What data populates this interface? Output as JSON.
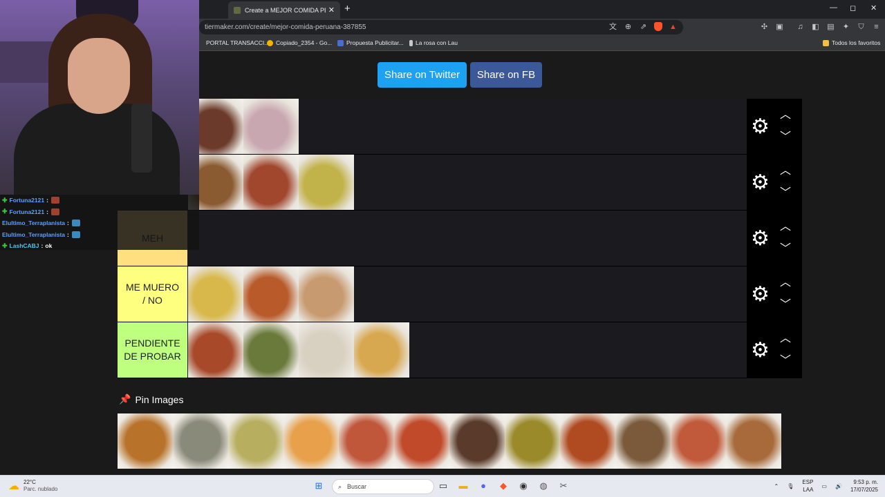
{
  "browser": {
    "tab_title": "Create a MEJOR COMIDA PERUANA",
    "url": "tiermaker.com/create/mejor-comida-peruana-387855",
    "bookmarks": [
      "PORTAL TRANSACCI...",
      "Copiado_2354 - Go...",
      "Propuesta Publicitar...",
      "La rosa con Lau"
    ],
    "bookmarks_folder": "Todos los favoritos",
    "new_tab_symbol": "+",
    "close_symbol": "✕"
  },
  "page": {
    "share_twitter": "Share on Twitter",
    "share_fb": "Share on FB",
    "pin_title": "Pin Images"
  },
  "tiers": [
    {
      "label": "",
      "color": "#1a1a1f",
      "items": [
        "#6b3a2a",
        "#c9a7b0"
      ]
    },
    {
      "label": "",
      "color": "#1a1a1f",
      "items": [
        "#8a5a30",
        "#a0472e",
        "#c2b24a"
      ]
    },
    {
      "label": "MEH",
      "color": "#ffdf80",
      "items": []
    },
    {
      "label": "ME MUERO / NO",
      "color": "#ffff7f",
      "items": [
        "#d8b84a",
        "#b85a2a",
        "#c89a70"
      ]
    },
    {
      "label": "PENDIENTE DE PROBAR",
      "color": "#bfff7f",
      "items": [
        "#a84a2a",
        "#6a7a3a",
        "#d8d0c0",
        "#d8a850"
      ]
    }
  ],
  "pin_images": [
    "#b8722a",
    "#8a8a7a",
    "#b8ae60",
    "#e8a04a",
    "#c0563a",
    "#c04a2a",
    "#5a3a2a",
    "#9a8a2a",
    "#b04a20",
    "#7a5a3a",
    "#c05a3a",
    "#a86a3a"
  ],
  "chat": [
    {
      "user": "Fortuna2121",
      "msg": "",
      "emote": "#a04030"
    },
    {
      "user": "Fortuna2121",
      "msg": "",
      "emote": "#a04030"
    },
    {
      "user": "Elultimo_Terraplanista",
      "msg": "",
      "emote": "#3a8ac0"
    },
    {
      "user": "Elultimo_Terraplanista",
      "msg": "",
      "emote": "#3a8ac0"
    },
    {
      "user": "LashCABJ",
      "msg": "ok",
      "emote": ""
    }
  ],
  "taskbar": {
    "temp": "22°C",
    "weather": "Parc. nublado",
    "search": "Buscar",
    "lang1": "ESP",
    "lang2": "LAA",
    "time": "9:53 p. m.",
    "date": "17/07/2025"
  }
}
